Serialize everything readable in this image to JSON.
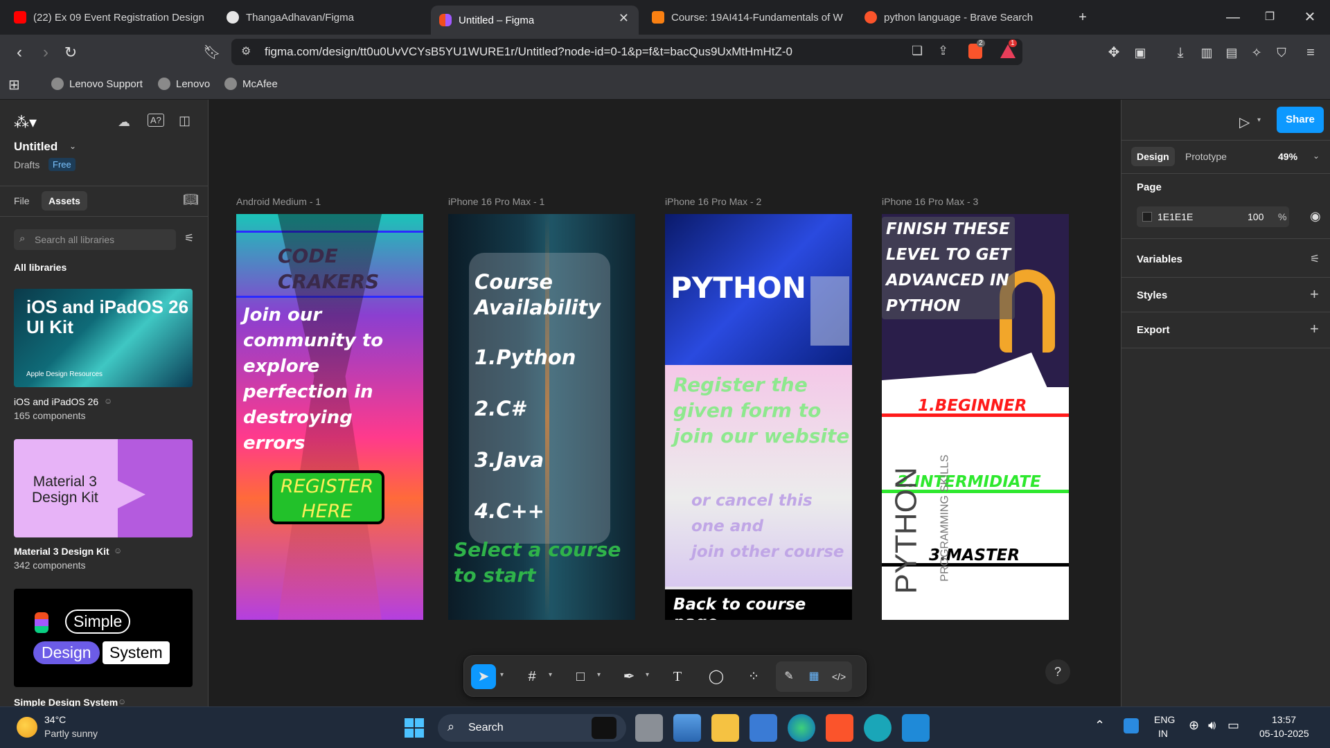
{
  "browser": {
    "tabs": [
      {
        "label": "(22) Ex 09 Event Registration Design",
        "icon": "youtube-icon",
        "active": false
      },
      {
        "label": "ThangaAdhavan/Figma",
        "icon": "github-icon",
        "active": false
      },
      {
        "label": "Untitled – Figma",
        "icon": "figma-icon",
        "active": true
      },
      {
        "label": "Course: 19AI414-Fundamentals of W",
        "icon": "moodle-icon",
        "active": false
      },
      {
        "label": "python language - Brave Search",
        "icon": "brave-icon",
        "active": false
      }
    ],
    "url": "figma.com/design/tt0u0UvVCYsB5YU1WURE1r/Untitled?node-id=0-1&p=f&t=bacQus9UxMtHmHtZ-0",
    "brave_badge": "2",
    "alert_badge": "1",
    "bookmarks": [
      "Lenovo Support",
      "Lenovo",
      "McAfee"
    ]
  },
  "figma": {
    "file_title": "Untitled",
    "location": "Drafts",
    "plan_badge": "Free",
    "panel_tabs": [
      "File",
      "Assets"
    ],
    "search_placeholder": "Search all libraries",
    "all_libraries": "All libraries",
    "libraries": [
      {
        "thumb_title": "iOS and iPadOS 26\nUI Kit",
        "thumb_sub": "Apple Design Resources",
        "name": "iOS and iPadOS 26",
        "count": "165 components"
      },
      {
        "thumb_title": "Material 3\nDesign Kit",
        "name": "Material 3 Design Kit",
        "count": "342 components"
      },
      {
        "thumb_words": [
          "Simple",
          "Design",
          "System"
        ],
        "name": "Simple Design System"
      }
    ],
    "frames": [
      {
        "label": "Android Medium - 1"
      },
      {
        "label": "iPhone 16 Pro Max - 1"
      },
      {
        "label": "iPhone 16 Pro Max - 2"
      },
      {
        "label": "iPhone 16 Pro Max - 3"
      }
    ],
    "frame1": {
      "title": "CODE\nCRAKERS",
      "body": "Join our\ncommunity to\nexplore\nperfection in\ndestroying\nerrors",
      "button": "REGISTER\nHERE"
    },
    "frame2": {
      "heading": "Course\nAvailability",
      "items": [
        "1.Python",
        "2.C#",
        "3.Java",
        "4.C++"
      ],
      "footer": "Select a course\nto start"
    },
    "frame3": {
      "banner": "PYTHON",
      "register": "Register the\ngiven form to\njoin our website",
      "cancel": "or cancel this\none and\njoin other course",
      "back": "Back to course page"
    },
    "frame4": {
      "heading": "FINISH THESE\nLEVEL TO GET\nADVANCED IN\nPYTHON",
      "levels": [
        "1.BEGINNER",
        "2.INTERMIDIATE",
        "3.MASTER"
      ],
      "vertical_big": "PYTHON",
      "vertical_small": "PROGRAMMING SKILLS"
    },
    "right": {
      "share": "Share",
      "tabs": [
        "Design",
        "Prototype"
      ],
      "zoom": "49%",
      "page_section": "Page",
      "page_color": "1E1E1E",
      "page_opacity": "100",
      "percent": "%",
      "sections": [
        "Variables",
        "Styles",
        "Export"
      ]
    },
    "help": "?"
  },
  "taskbar": {
    "weather_temp": "34°C",
    "weather_desc": "Partly sunny",
    "search": "Search",
    "lang1": "ENG",
    "lang2": "IN",
    "time": "13:57",
    "date": "05-10-2025"
  },
  "colors": {
    "accent_blue": "#0d99ff",
    "figma_panel": "#2c2c2c",
    "canvas": "#1e1e1e"
  }
}
